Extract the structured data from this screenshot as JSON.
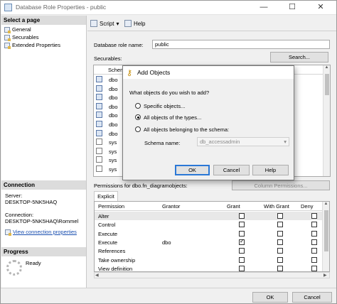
{
  "window": {
    "title": "Database Role Properties - public",
    "minimize": "—",
    "maximize": "☐",
    "close": "✕"
  },
  "left_pane": {
    "select_page_header": "Select a page",
    "pages": [
      "General",
      "Securables",
      "Extended Properties"
    ],
    "connection_header": "Connection",
    "server_label": "Server:",
    "server_value": "DESKTOP-5NK5HAQ",
    "connection_label": "Connection:",
    "connection_value": "DESKTOP-5NK5HAQ\\Rommel",
    "view_connection_properties": "View connection properties",
    "progress_header": "Progress",
    "progress_status": "Ready"
  },
  "toolbar": {
    "script_label": "Script",
    "help_label": "Help"
  },
  "general": {
    "role_name_label": "Database role name:",
    "role_name_value": "public",
    "securables_label": "Securables:",
    "search_button": "Search..."
  },
  "securables_grid": {
    "column_header": "Schema",
    "rows": [
      {
        "schema": "dbo",
        "icon": "table-icon"
      },
      {
        "schema": "dbo",
        "icon": "table-icon"
      },
      {
        "schema": "dbo",
        "icon": "table-icon"
      },
      {
        "schema": "dbo",
        "icon": "table-icon"
      },
      {
        "schema": "dbo",
        "icon": "table-icon"
      },
      {
        "schema": "dbo",
        "icon": "table-icon"
      },
      {
        "schema": "dbo",
        "icon": "table-icon"
      },
      {
        "schema": "sys",
        "icon": "view-icon"
      },
      {
        "schema": "sys",
        "icon": "view-icon"
      },
      {
        "schema": "sys",
        "icon": "view-icon"
      },
      {
        "schema": "sys",
        "icon": "view-icon"
      }
    ]
  },
  "permissions": {
    "label": "Permissions for dbo.fn_diagramobjects:",
    "column_permissions_button": "Column Permissions...",
    "tab_explicit": "Explicit",
    "headers": [
      "Permission",
      "Grantor",
      "Grant",
      "With Grant",
      "Deny"
    ],
    "rows": [
      {
        "permission": "Alter",
        "grantor": "",
        "grant": false,
        "with_grant": false,
        "deny": false
      },
      {
        "permission": "Control",
        "grantor": "",
        "grant": false,
        "with_grant": false,
        "deny": false
      },
      {
        "permission": "Execute",
        "grantor": "",
        "grant": false,
        "with_grant": false,
        "deny": false
      },
      {
        "permission": "Execute",
        "grantor": "dbo",
        "grant": true,
        "with_grant": false,
        "deny": false
      },
      {
        "permission": "References",
        "grantor": "",
        "grant": false,
        "with_grant": false,
        "deny": false
      },
      {
        "permission": "Take ownership",
        "grantor": "",
        "grant": false,
        "with_grant": false,
        "deny": false
      },
      {
        "permission": "View definition",
        "grantor": "",
        "grant": false,
        "with_grant": false,
        "deny": false
      }
    ]
  },
  "footer": {
    "ok": "OK",
    "cancel": "Cancel"
  },
  "add_objects_dialog": {
    "title": "Add Objects",
    "question": "What objects do you wish to add?",
    "options": [
      {
        "label": "Specific objects...",
        "selected": false
      },
      {
        "label": "All objects of the types...",
        "selected": true
      },
      {
        "label": "All objects belonging to the schema:",
        "selected": false
      }
    ],
    "schema_name_label": "Schema name:",
    "schema_name_value": "db_accessadmin",
    "ok": "OK",
    "cancel": "Cancel",
    "help": "Help"
  },
  "colors": {
    "accent": "#2b78d6",
    "link": "#1a4fb0",
    "header_bg": "#dcdcdc",
    "selected_row": "#cce4f7"
  }
}
